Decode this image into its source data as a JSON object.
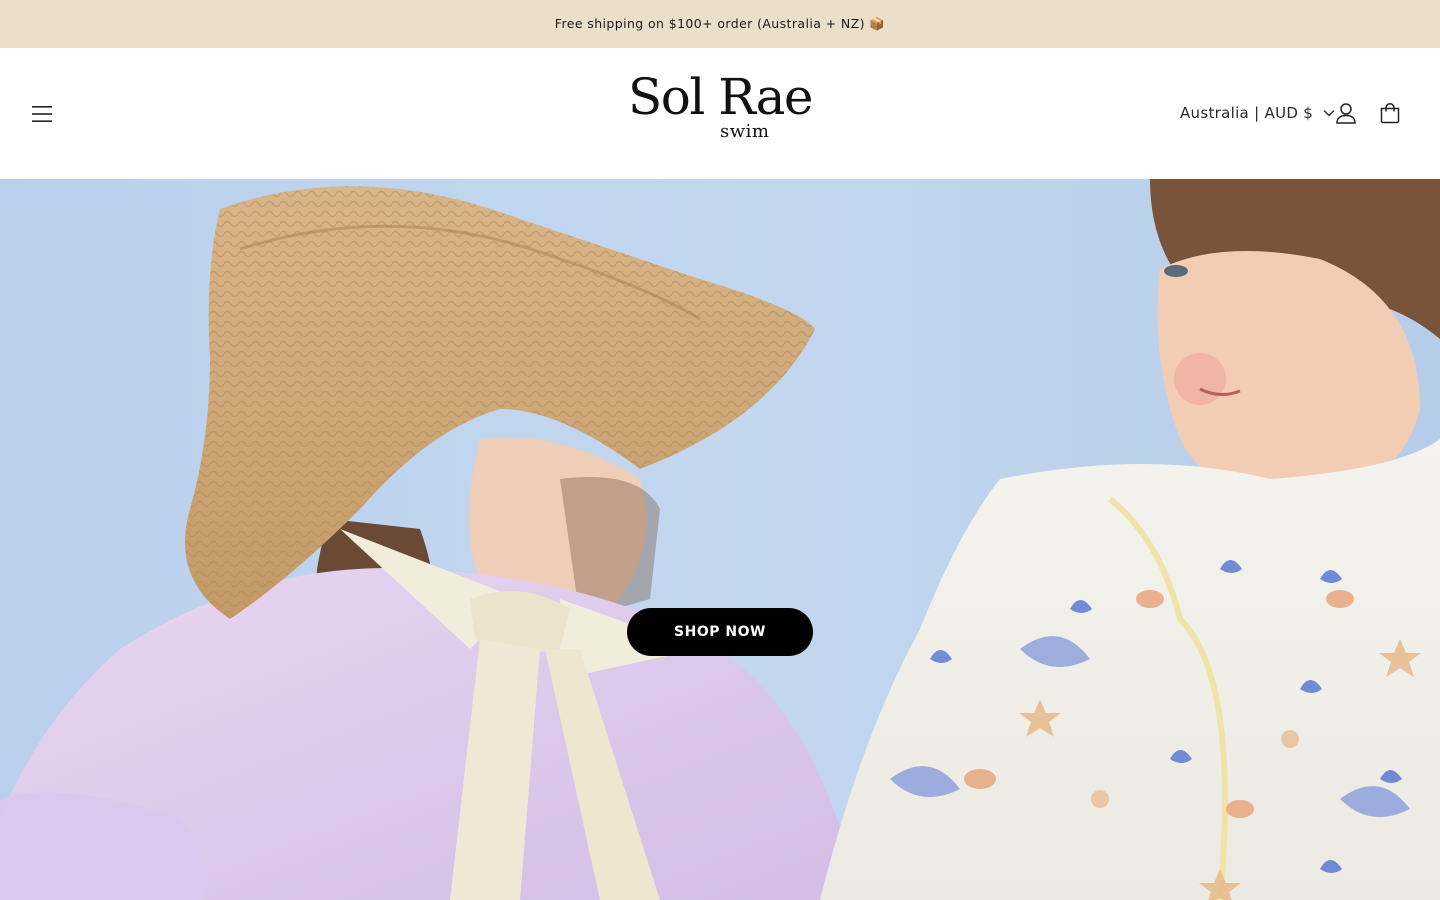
{
  "announcement": {
    "text": "Free shipping on $100+ order (Australia + NZ) 📦"
  },
  "header": {
    "menu_icon": "hamburger-menu-icon",
    "logo": {
      "main": "Sol Rae",
      "sub": "swim"
    },
    "currency_selector": {
      "selected": "Australia | AUD $",
      "icon": "chevron-down-icon"
    },
    "account_icon": "account-icon",
    "cart_icon": "cart-bag-icon"
  },
  "hero": {
    "cta_label": "SHOP NOW",
    "image": "children-in-swimwear-photo"
  },
  "colors": {
    "announcement_bg": "#ecdfc9",
    "cta_bg": "#000000",
    "cta_text": "#ffffff",
    "hero_bg": "#bcd3ec"
  }
}
